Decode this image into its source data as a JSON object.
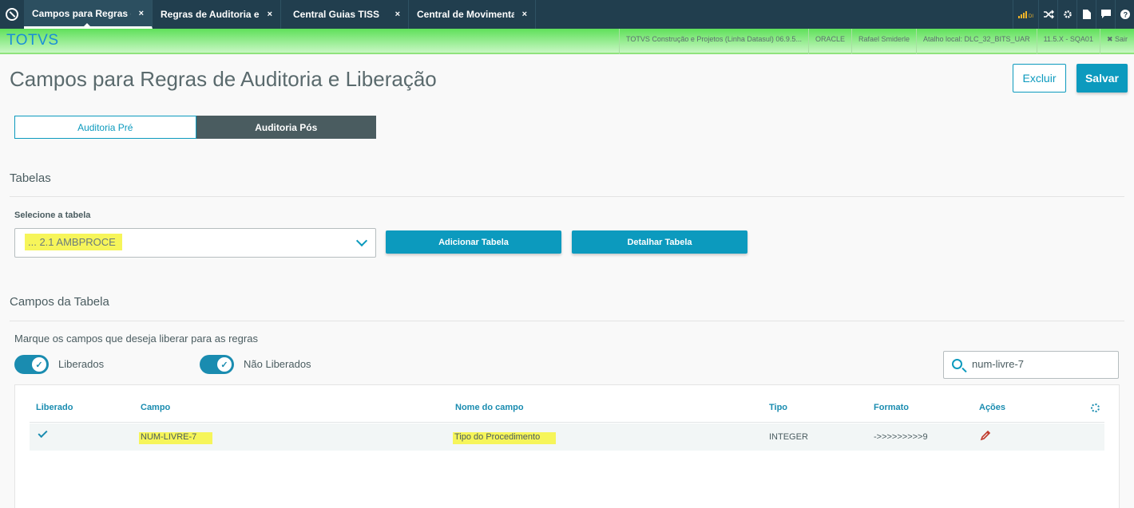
{
  "topbar": {
    "tabs": [
      {
        "label": "Campos para Regras d",
        "close": "×"
      },
      {
        "label": "Regras de Auditoria e",
        "close": "×"
      },
      {
        "label": "Central Guias TISS",
        "close": "×"
      },
      {
        "label": "Central de Movimenta",
        "close": "×"
      }
    ],
    "icons": [
      "signal-icon",
      "shuffle-icon",
      "gear-icon",
      "document-icon",
      "chat-icon",
      "help-icon"
    ]
  },
  "header": {
    "brand": "TOTVS",
    "info": [
      "TOTVS Construção e Projetos (Linha Datasul) 06.9.5...",
      "ORACLE",
      "Rafael Smiderle",
      "Atalho local: DLC_32_BITS_UAR",
      "11.5.X - SQA01",
      "✖ Sair"
    ]
  },
  "page": {
    "title": "Campos para Regras de Auditoria e Liberação",
    "excluir": "Excluir",
    "salvar": "Salvar",
    "seg_tabs": [
      "Auditoria Pré",
      "Auditoria Pós"
    ],
    "active_tab": "Auditoria Pós"
  },
  "tabelas": {
    "heading": "Tabelas",
    "select_label": "Selecione a tabela",
    "select_value": "... 2.1 AMBPROCE",
    "add_button": "Adicionar Tabela",
    "detail_button": "Detalhar Tabela"
  },
  "campos": {
    "heading": "Campos da Tabela",
    "hint": "Marque os campos que deseja liberar para as regras",
    "toggle_liberados": "Liberados",
    "toggle_nao_liberados": "Não Liberados",
    "search_value": "num-livre-7",
    "columns": [
      "Liberado",
      "Campo",
      "Nome do campo",
      "Tipo",
      "Formato",
      "Ações"
    ],
    "rows": [
      {
        "liberado": true,
        "campo": "NUM-LIVRE-7",
        "nome": "Tipo do Procedimento",
        "tipo": "INTEGER",
        "formato": "->>>>>>>>>9"
      }
    ]
  },
  "colors": {
    "accent": "#0c9abe",
    "topbar": "#213e4e",
    "green": "#5fe05a",
    "highlight": "#f6f55a"
  }
}
